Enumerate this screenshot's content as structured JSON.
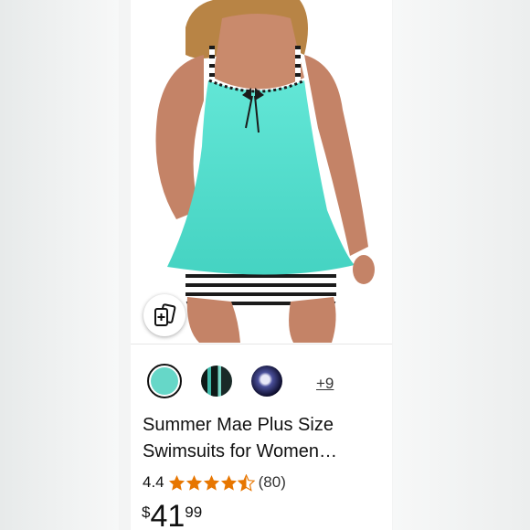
{
  "product": {
    "title_line1": "Summer Mae Plus Size",
    "title_line2": "Swimsuits for Women…",
    "rating": "4.4",
    "rating_stars": 4.4,
    "review_count": "(80)",
    "price_symbol": "$",
    "price_whole": "41",
    "price_fraction": "99",
    "more_colors": "+9",
    "image_icon": "swimsuit-model-photo",
    "try_on_icon": "virtual-try-on-icon"
  },
  "colors": {
    "swimsuit_top": "#5ee3d3",
    "star": "#e77600",
    "selected_swatch": "#66d7c8"
  }
}
